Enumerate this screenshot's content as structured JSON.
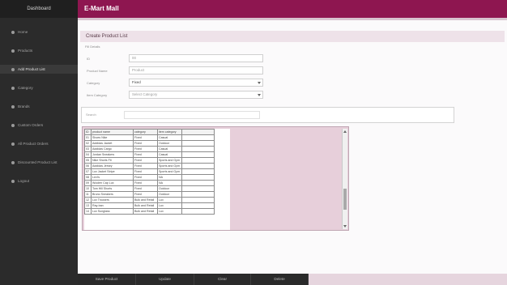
{
  "sidebar": {
    "title": "Dashboard",
    "items": [
      {
        "label": "Home"
      },
      {
        "label": "Products"
      },
      {
        "label": "Add Product List"
      },
      {
        "label": "Category"
      },
      {
        "label": "Brands"
      },
      {
        "label": "Custom Orders"
      },
      {
        "label": "All Product Orders"
      },
      {
        "label": "Discounted Product List"
      },
      {
        "label": "Logout"
      }
    ]
  },
  "header": {
    "app_title": "E-Mart Mall"
  },
  "page": {
    "title": "Create Product List"
  },
  "form": {
    "section_label": "Fill Details",
    "fields": {
      "id": {
        "label": "ID",
        "value": "00"
      },
      "product_name": {
        "label": "Product Name",
        "value": "Product"
      },
      "category": {
        "label": "Category",
        "value": "Fixed"
      },
      "item_category": {
        "label": "Item Category",
        "value": "Select Category"
      }
    }
  },
  "search": {
    "label": "Search",
    "placeholder": ""
  },
  "table": {
    "columns": [
      "ID",
      "product name",
      "category",
      "item category",
      ""
    ],
    "rows": [
      [
        "01",
        "Shoes Nike",
        "Fixed",
        "Casual",
        ""
      ],
      [
        "02",
        "Addidas Jacket",
        "Fixed",
        "Outdoor",
        ""
      ],
      [
        "03",
        "Addidas Cargo",
        "Fixed",
        "Casual",
        ""
      ],
      [
        "04",
        "Jordan Sneakers",
        "Fixed",
        "Casual",
        ""
      ],
      [
        "05",
        "Nike Shorts Fit",
        "Fixed",
        "Sports and Gym",
        ""
      ],
      [
        "06",
        "Addidas Jersey",
        "Fixed",
        "Sports and Gym",
        ""
      ],
      [
        "07",
        "Lux Jacket Stripe",
        "Fixed",
        "Sports and Gym",
        ""
      ],
      [
        "08",
        "Levi's",
        "Fixed",
        "NA",
        ""
      ],
      [
        "09",
        "Woolen Cap Lux",
        "Fixed",
        "NA",
        ""
      ],
      [
        "10",
        "Tom Hill Shorts",
        "Fixed",
        "Outdoor",
        ""
      ],
      [
        "11",
        "Bruno Sneakers",
        "Fixed",
        "Outdoor",
        ""
      ],
      [
        "12",
        "Lux Trousers",
        "Bulk and Retail",
        "Lux",
        ""
      ],
      [
        "13",
        "Ray-ban",
        "Bulk and Retail",
        "Lux",
        ""
      ],
      [
        "14",
        "Lux Sunglass",
        "Bulk and Retail",
        "Lux",
        ""
      ]
    ]
  },
  "actions": {
    "buttons": [
      "Save Product",
      "Update",
      "Clear",
      "Delete"
    ]
  }
}
